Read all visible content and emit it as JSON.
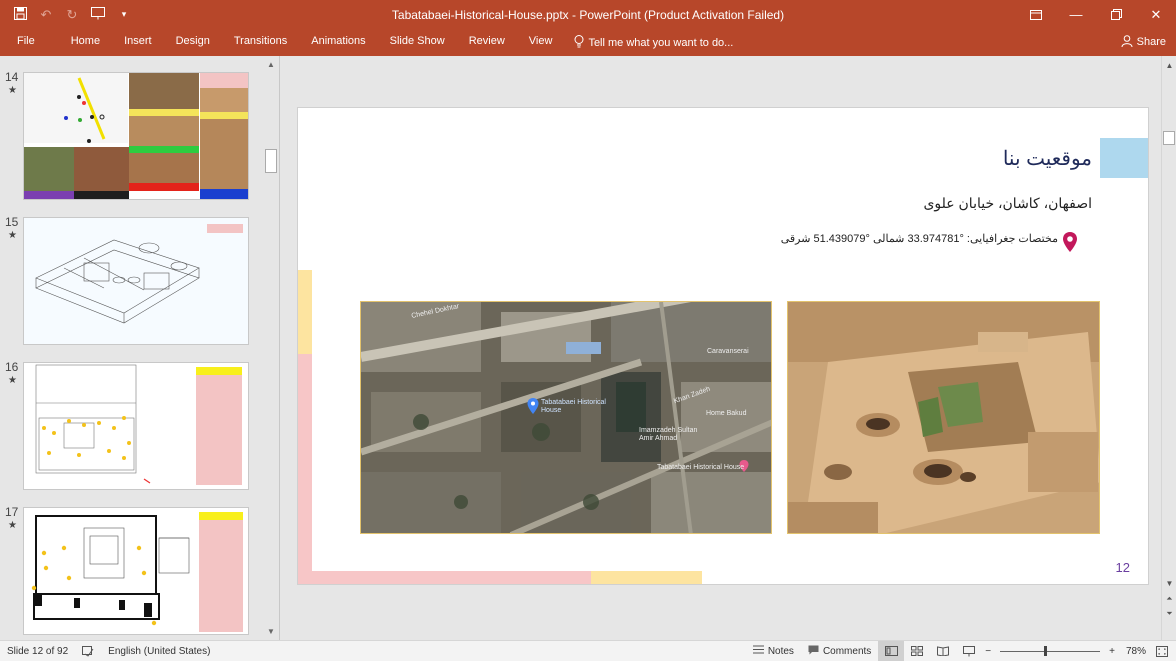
{
  "window": {
    "title": "Tabatabaei-Historical-House.pptx - PowerPoint (Product Activation Failed)"
  },
  "ribbon": {
    "tabs": [
      "File",
      "Home",
      "Insert",
      "Design",
      "Transitions",
      "Animations",
      "Slide Show",
      "Review",
      "View"
    ],
    "tell_me": "Tell me what you want to do...",
    "share": "Share"
  },
  "thumbnails": [
    {
      "number": "14",
      "star": "★"
    },
    {
      "number": "15",
      "star": "★"
    },
    {
      "number": "16",
      "star": "★"
    },
    {
      "number": "17",
      "star": "★"
    }
  ],
  "slide": {
    "title": "موقعیت بنا",
    "address": "اصفهان، کاشان، خیابان علوی",
    "coordinates": "مختصات جغرافیایی: °33.974781 شمالی °51.439079 شرقی",
    "number": "12",
    "map_labels": {
      "place": "Tabatabaei Historical House",
      "mausoleum": "Imamzadeh Sultan Amir Ahmad",
      "house_bottom": "Tabatabaei Historical House",
      "street_top": "Chehel Dokhtar",
      "hotel": "Caravanserai",
      "other": "Khan Zadeh",
      "cafe": "Home Bakud"
    },
    "accent_colors": {
      "blue": "#aed8ee",
      "pink": "#f7c6c7",
      "yellow": "#fde4a0",
      "title": "#1f2a5a",
      "number": "#6b3fa0"
    }
  },
  "status": {
    "slide_info": "Slide 12 of 92",
    "language": "English (United States)",
    "notes": "Notes",
    "comments": "Comments",
    "zoom": "78%"
  }
}
